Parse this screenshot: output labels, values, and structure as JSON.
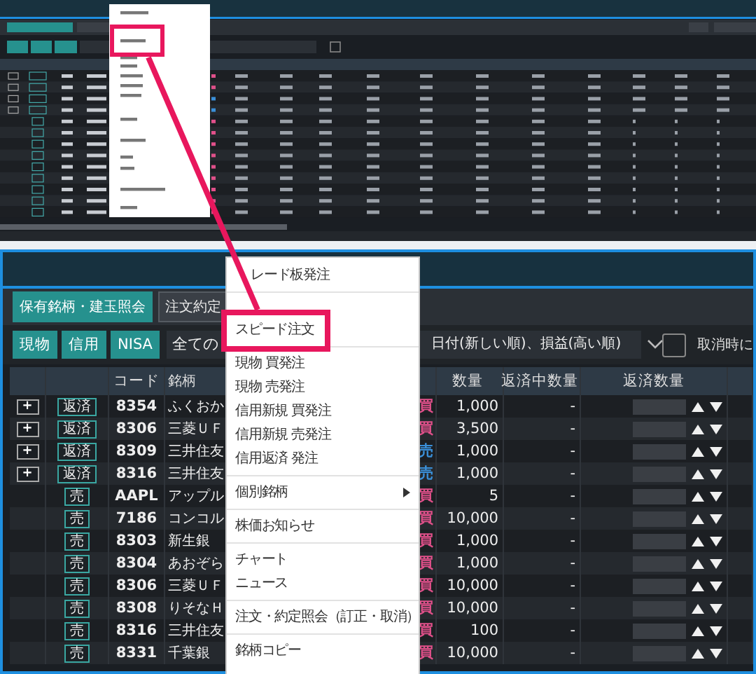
{
  "tabs": [
    {
      "label": "保有銘柄・建玉照会",
      "selected": true
    },
    {
      "label": "注文約定",
      "selected": false
    }
  ],
  "filters": [
    {
      "label": "現物",
      "on": true
    },
    {
      "label": "信用",
      "on": true
    },
    {
      "label": "NISA",
      "on": true
    }
  ],
  "stock_select": {
    "value": "全ての"
  },
  "sort_select": {
    "value": "日付(新しい順)、損益(高い順)"
  },
  "confirm_checkbox": {
    "label": "取消時に",
    "checked": false
  },
  "table": {
    "columns": [
      "コード",
      "銘柄",
      "数量",
      "返済中数量",
      "返済数量"
    ],
    "rows": [
      {
        "expand": "+",
        "action": "返済",
        "code": "8354",
        "name": "ふくおか",
        "side": "買",
        "color": "#e0508a",
        "quantity": "1,000",
        "pending": "-"
      },
      {
        "expand": "+",
        "action": "返済",
        "code": "8306",
        "name": "三菱ＵＦ",
        "side": "買",
        "color": "#e0508a",
        "quantity": "3,500",
        "pending": "-"
      },
      {
        "expand": "+",
        "action": "返済",
        "code": "8309",
        "name": "三井住友",
        "side": "売",
        "color": "#3a8fd8",
        "quantity": "1,000",
        "pending": "-"
      },
      {
        "expand": "+",
        "action": "返済",
        "code": "8316",
        "name": "三井住友",
        "side": "売",
        "color": "#3a8fd8",
        "quantity": "1,000",
        "pending": "-"
      },
      {
        "action": "売",
        "code": "AAPL",
        "name": "アップル",
        "side": "買",
        "color": "#e0508a",
        "quantity": "5",
        "pending": "-"
      },
      {
        "action": "売",
        "code": "7186",
        "name": "コンコル",
        "side": "買",
        "color": "#e0508a",
        "quantity": "10,000",
        "pending": "-"
      },
      {
        "action": "売",
        "code": "8303",
        "name": "新生銀",
        "side": "買",
        "color": "#e0508a",
        "quantity": "1,000",
        "pending": "-"
      },
      {
        "action": "売",
        "code": "8304",
        "name": "あおぞら",
        "side": "買",
        "color": "#e0508a",
        "quantity": "1,000",
        "pending": "-"
      },
      {
        "action": "売",
        "code": "8306",
        "name": "三菱ＵＦ",
        "side": "買",
        "color": "#e0508a",
        "quantity": "10,000",
        "pending": "-"
      },
      {
        "action": "売",
        "code": "8308",
        "name": "りそなＨ",
        "side": "買",
        "color": "#e0508a",
        "quantity": "10,000",
        "pending": "-"
      },
      {
        "action": "売",
        "code": "8316",
        "name": "三井住友",
        "side": "買",
        "color": "#e0508a",
        "quantity": "100",
        "pending": "-"
      },
      {
        "action": "売",
        "code": "8331",
        "name": "千葉銀",
        "side": "買",
        "color": "#e0508a",
        "quantity": "10,000",
        "pending": "-"
      }
    ]
  },
  "context_menu": {
    "items": [
      {
        "kind": "item",
        "label": "レード板発注",
        "highlighted": false
      },
      {
        "kind": "separator"
      },
      {
        "kind": "item",
        "label": "スピード注文",
        "highlighted": true
      },
      {
        "kind": "separator"
      },
      {
        "kind": "item",
        "label": "現物 買発注",
        "highlighted": false
      },
      {
        "kind": "item",
        "label": "現物 売発注",
        "highlighted": false
      },
      {
        "kind": "item",
        "label": "信用新規 買発注",
        "highlighted": false
      },
      {
        "kind": "item",
        "label": "信用新規 売発注",
        "highlighted": false
      },
      {
        "kind": "item",
        "label": "信用返済 発注",
        "highlighted": false
      },
      {
        "kind": "separator"
      },
      {
        "kind": "submenu",
        "label": "個別銘柄",
        "highlighted": false
      },
      {
        "kind": "separator"
      },
      {
        "kind": "item",
        "label": "株価お知らせ",
        "highlighted": false
      },
      {
        "kind": "separator"
      },
      {
        "kind": "item",
        "label": "チャート",
        "highlighted": false
      },
      {
        "kind": "item",
        "label": "ニュース",
        "highlighted": false
      },
      {
        "kind": "separator"
      },
      {
        "kind": "item",
        "label": "注文・約定照会（訂正・取消）",
        "highlighted": false
      },
      {
        "kind": "separator"
      },
      {
        "kind": "item",
        "label": "銘柄コピー",
        "highlighted": false
      }
    ]
  }
}
